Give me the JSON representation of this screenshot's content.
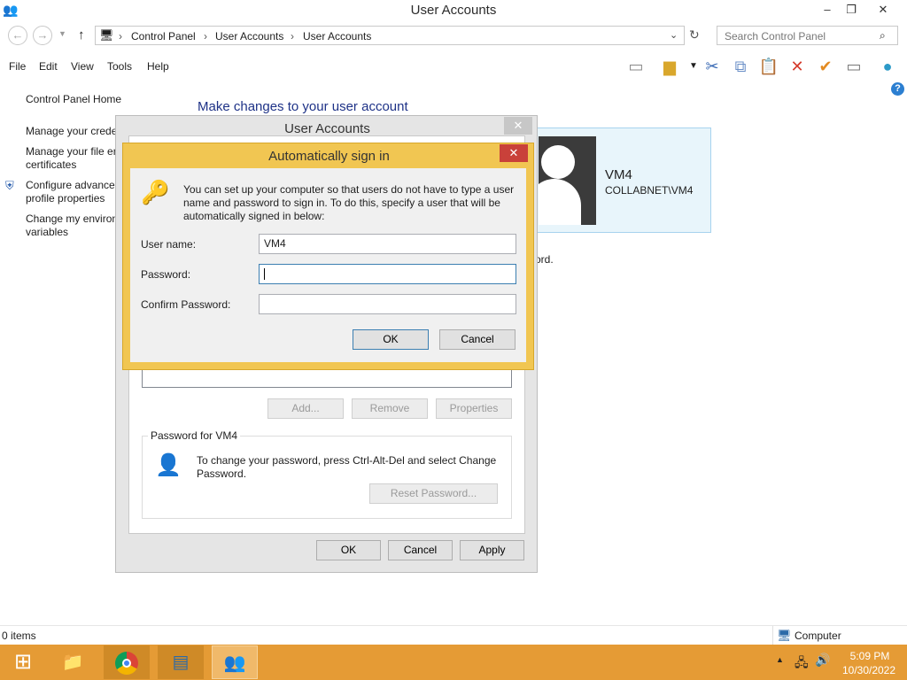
{
  "window": {
    "title": "User Accounts",
    "minimize": "–",
    "maximize": "❐",
    "close": "✕"
  },
  "address": {
    "back": "←",
    "forward": "→",
    "up": "↑",
    "crumbs": [
      "Control Panel",
      "User Accounts",
      "User Accounts"
    ],
    "sep": "›",
    "search_placeholder": "Search Control Panel"
  },
  "menu": {
    "file": "File",
    "edit": "Edit",
    "view": "View",
    "tools": "Tools",
    "help": "Help"
  },
  "left_pane": {
    "home": "Control Panel Home",
    "items": [
      "Manage your crede",
      "Manage your file er",
      "certificates",
      "Configure advance",
      "profile properties",
      "Change my environ",
      "variables"
    ]
  },
  "main": {
    "heading": "Make changes to your user account",
    "password_tail": "ord."
  },
  "user_card": {
    "name": "VM4",
    "domain": "COLLABNET\\VM4"
  },
  "user_accounts_dialog": {
    "title": "User Accounts",
    "close": "✕",
    "buttons": {
      "add": "Add...",
      "remove": "Remove",
      "properties": "Properties"
    },
    "password_group": {
      "label": "Password for VM4",
      "text": "To change your password, press Ctrl-Alt-Del and select Change Password.",
      "reset": "Reset Password..."
    },
    "footer": {
      "ok": "OK",
      "cancel": "Cancel",
      "apply": "Apply"
    }
  },
  "auto_signin_dialog": {
    "title": "Automatically sign in",
    "close": "✕",
    "description": "You can set up your computer so that users do not have to type a user name and password to sign in. To do this, specify a user that will be automatically signed in below:",
    "username_label": "User name:",
    "username_value": "VM4",
    "password_label": "Password:",
    "password_value": "",
    "confirm_label": "Confirm Password:",
    "confirm_value": "",
    "ok": "OK",
    "cancel": "Cancel"
  },
  "status_bar": {
    "items": "0 items",
    "computer": "Computer"
  },
  "taskbar": {
    "time": "5:09 PM",
    "date": "10/30/2022"
  },
  "colors": {
    "taskbar": "#e59b35",
    "dialog_frame": "#f1c652",
    "close_red": "#c9413a",
    "heading_blue": "#1e3287"
  }
}
